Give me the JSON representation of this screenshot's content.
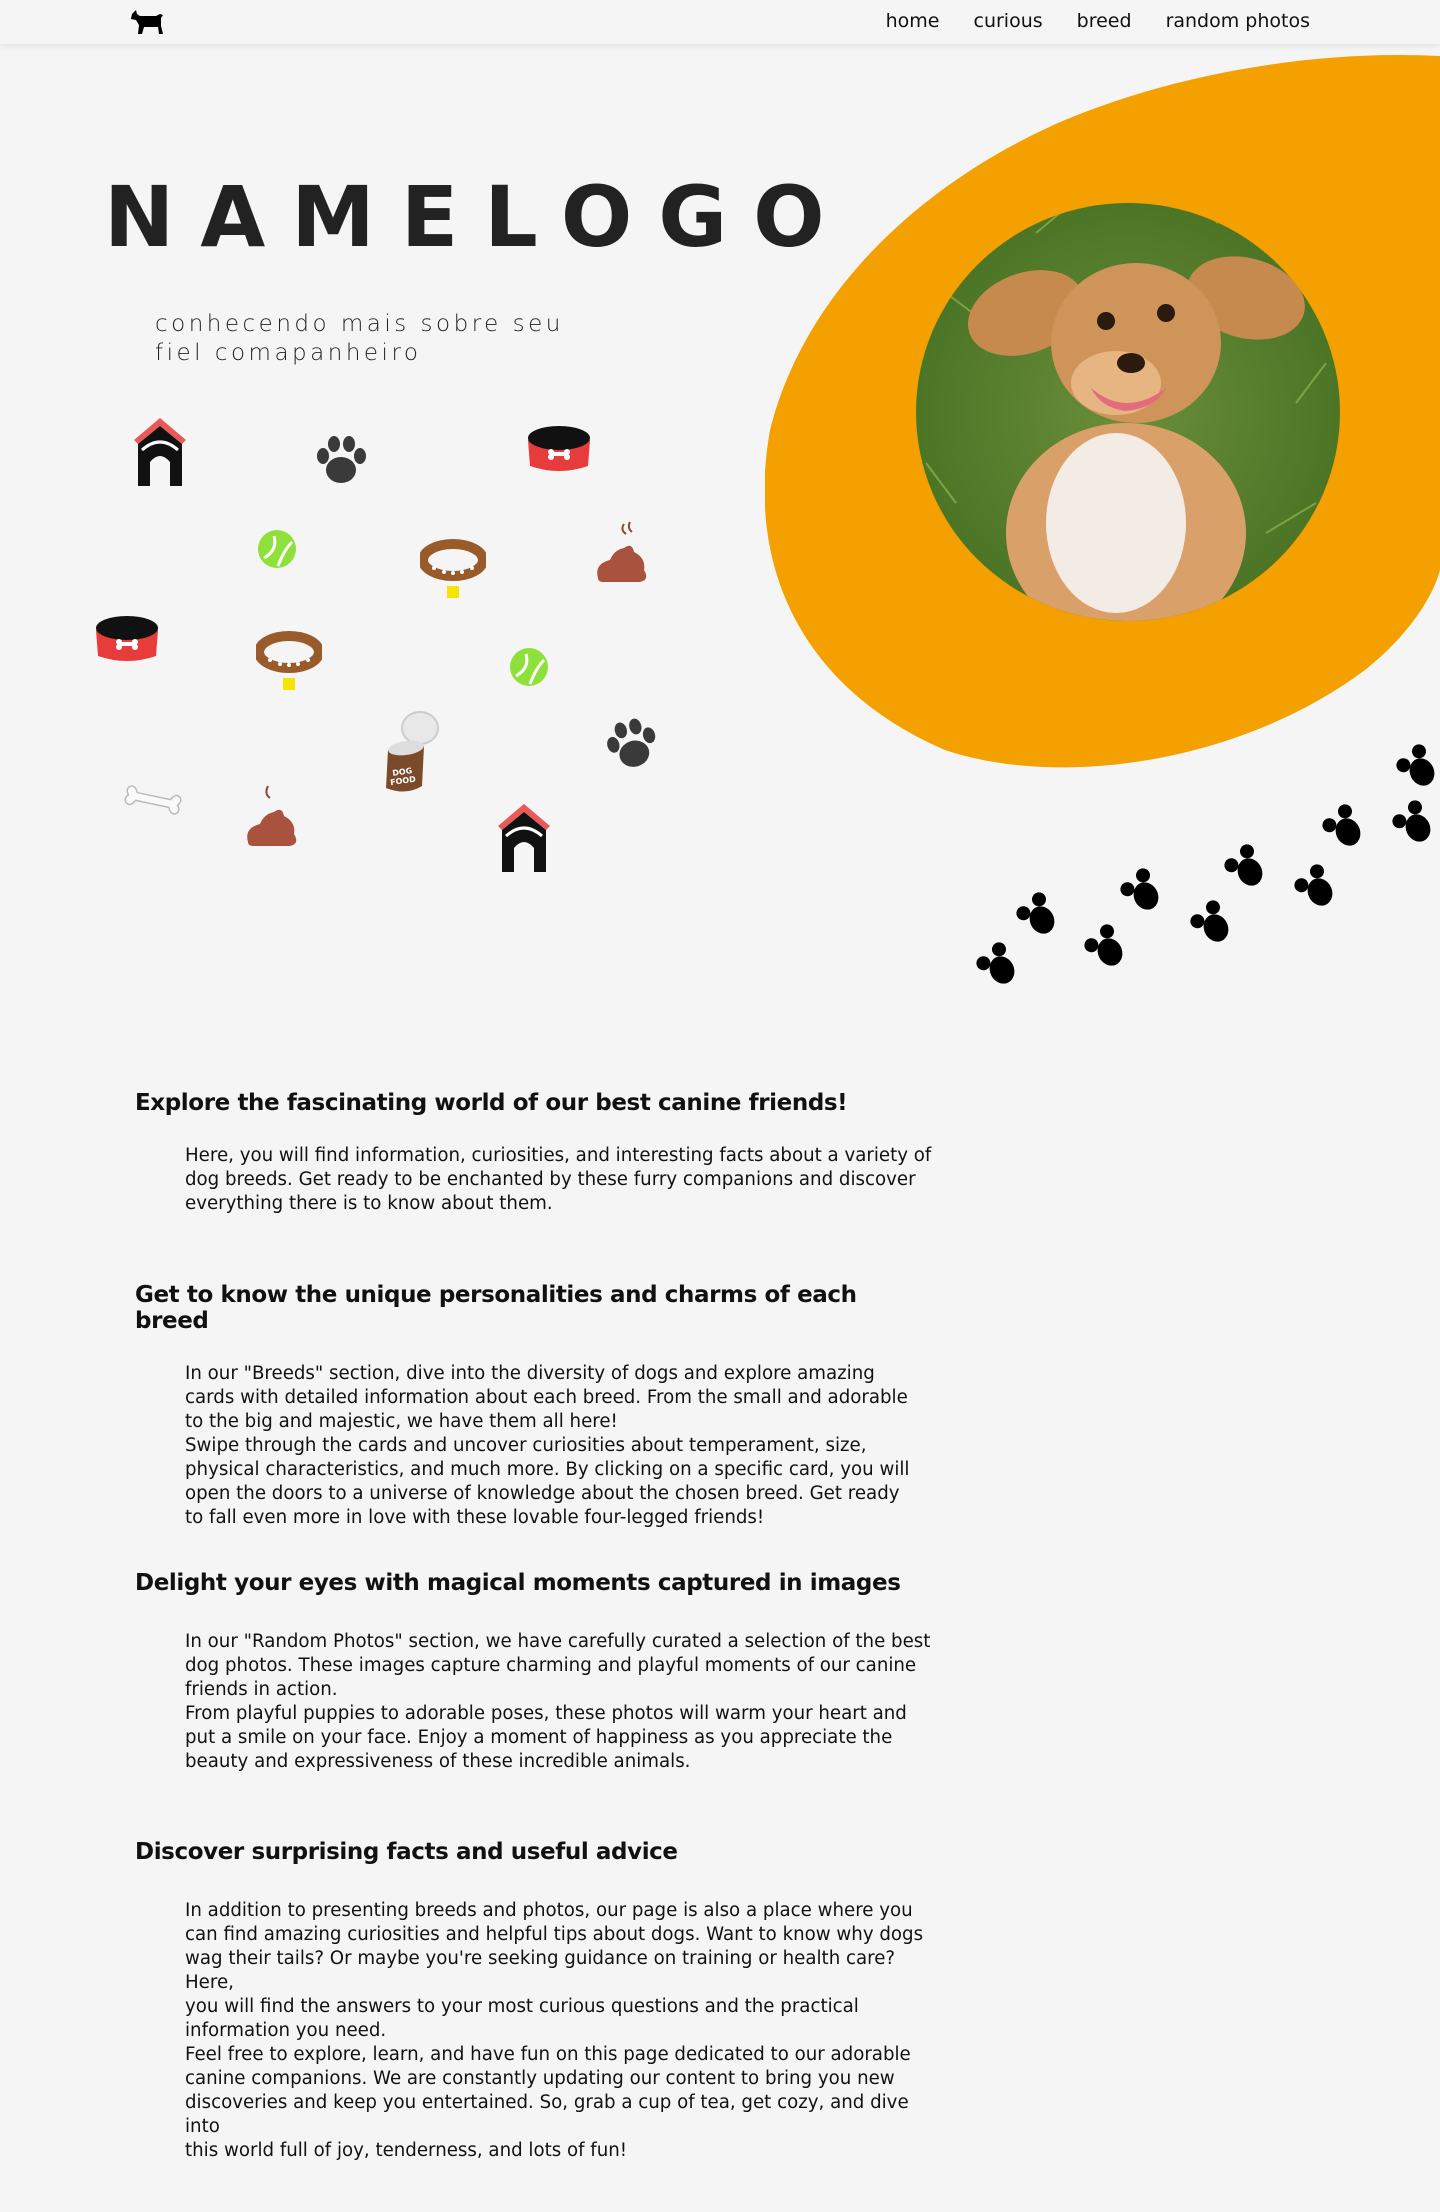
{
  "header": {
    "logo_icon": "dog-silhouette-icon",
    "nav": [
      {
        "label": "home"
      },
      {
        "label": "curious"
      },
      {
        "label": "breed"
      },
      {
        "label": "random photos"
      }
    ]
  },
  "hero": {
    "brand": "NAMELOGO",
    "tagline_line1": "conhecendo mais sobre seu",
    "tagline_line2": "fiel comapanheiro",
    "accent_color": "#f3a000",
    "photo_alt": "dog-photo"
  },
  "sections": [
    {
      "title": "Explore the fascinating world of our best canine friends!",
      "body": "Here, you will find information, curiosities, and interesting facts about a variety of\ndog breeds. Get ready to be enchanted by these furry companions and discover\neverything there is to know about them."
    },
    {
      "title": "Get to know the unique personalities and charms of each breed",
      "body": "In our \"Breeds\" section, dive into the diversity of dogs and explore amazing\ncards with detailed information about each breed. From the small and adorable\nto the big and majestic, we have them all here!\nSwipe through the cards and uncover curiosities about temperament, size,\nphysical characteristics, and much more. By clicking on a specific card, you will\nopen the doors to a universe of knowledge about the chosen breed. Get ready\nto fall even more in love with these lovable four-legged friends!"
    },
    {
      "title": "Delight your eyes with magical moments captured in images",
      "body": "In our \"Random Photos\" section, we have carefully curated a selection of the best\ndog photos. These images capture charming and playful moments of our canine\nfriends in action.\nFrom playful puppies to adorable poses, these photos will warm your heart and\nput a smile on your face. Enjoy a moment of happiness as you appreciate the\nbeauty and expressiveness of these incredible animals."
    },
    {
      "title": "Discover surprising facts and useful advice",
      "body": "In addition to presenting breeds and photos, our page is also a place where you\ncan find amazing curiosities and helpful tips about dogs. Want to know why dogs\nwag their tails? Or maybe you're seeking guidance on training or health care? Here,\nyou will find the answers to your most curious questions and the practical\ninformation you need.\nFeel free to explore, learn, and have fun on this page dedicated to our adorable\ncanine companions. We are constantly updating our content to bring you new\ndiscoveries and keep you entertained. So, grab a cup of tea, get cozy, and dive into\nthis world full of joy, tenderness, and lots of fun!"
    }
  ]
}
